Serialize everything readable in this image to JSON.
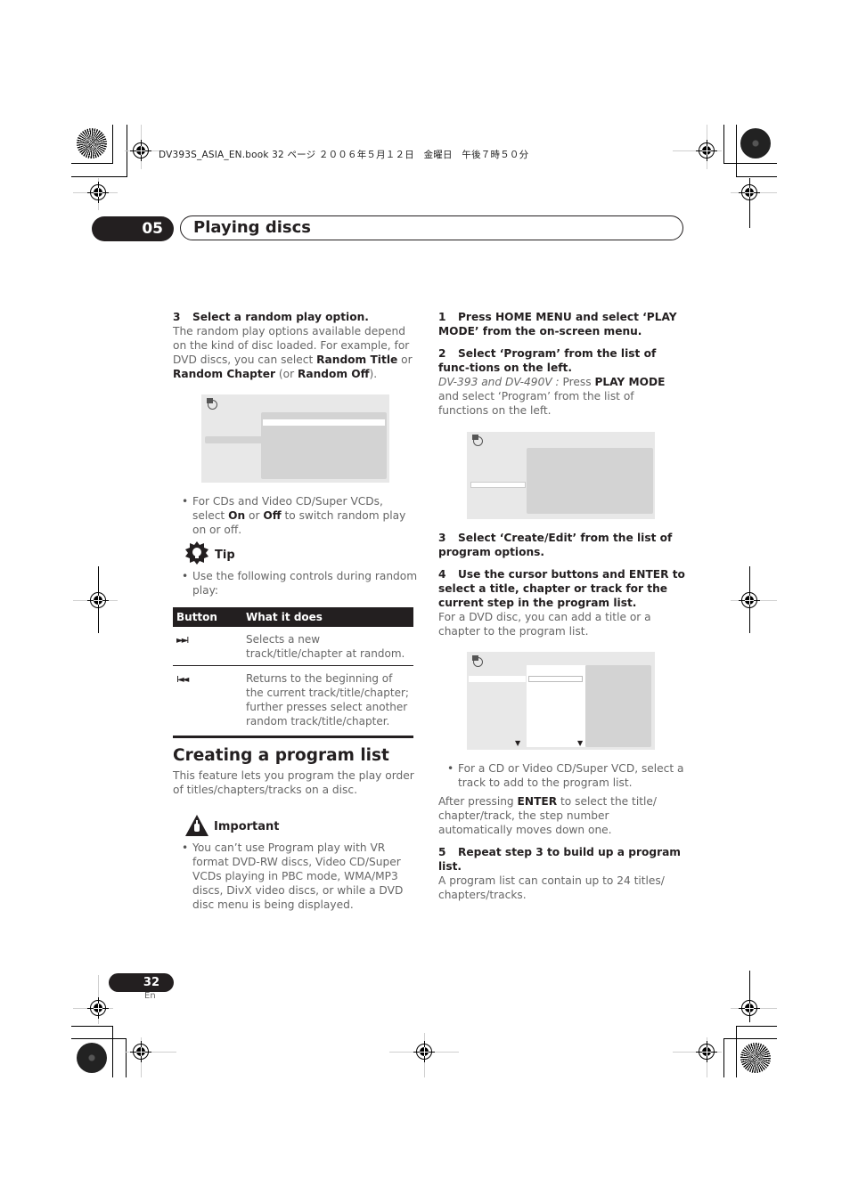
{
  "print_header": "DV393S_ASIA_EN.book  32 ページ  ２００６年５月１２日　金曜日　午後７時５０分",
  "chapter": {
    "number": "05",
    "title": "Playing discs"
  },
  "left_column": {
    "step3": {
      "num": "3",
      "title": "Select a random play option."
    },
    "step3_body": {
      "t1": "The random play options available depend on the kind of disc loaded. For example, for DVD discs, you can select ",
      "b1": "Random Title",
      "t2": " or ",
      "b2": "Random Chapter",
      "t3": " (or ",
      "b3": "Random Off",
      "t4": ")."
    },
    "bullet_cd": {
      "t1": "For CDs and Video CD/Super VCDs, select ",
      "b1": "On",
      "t2": " or ",
      "b2": "Off",
      "t3": " to switch random play on or off."
    },
    "tip": {
      "label": "Tip",
      "bullet": "Use the following controls during random play:"
    },
    "table": {
      "headers": [
        "Button",
        "What it does"
      ],
      "rows": [
        {
          "button": "►►I",
          "icon": "next-icon",
          "desc": "Selects a new track/title/chapter at random."
        },
        {
          "button": "I◄◄",
          "icon": "previous-icon",
          "desc": "Returns to the beginning of the current track/title/chapter; further presses select another random track/title/chapter."
        }
      ]
    },
    "section_title": "Creating a program list",
    "section_intro": "This feature lets you program the play order of titles/chapters/tracks on a disc.",
    "important": {
      "label": "Important",
      "bullet": "You can’t use Program play with VR format DVD-RW discs, Video CD/Super VCDs playing in PBC mode, WMA/MP3 discs, DivX video discs, or while a DVD disc menu is being displayed."
    }
  },
  "right_column": {
    "step1": {
      "num": "1",
      "title": "Press HOME MENU and select ‘PLAY MODE’ from the on-screen menu."
    },
    "step2": {
      "num": "2",
      "title": "Select ‘Program’ from the list of func-tions on the left."
    },
    "step2_body": {
      "i1": "DV-393 and DV-490V :",
      "t1": " Press ",
      "b1": "PLAY MODE",
      "t2": " and select ‘Program’ from the list of functions on the left."
    },
    "step3": {
      "num": "3",
      "title": "Select ‘Create/Edit’ from the list of program options."
    },
    "step4": {
      "num": "4",
      "title": "Use the cursor buttons and ENTER to select a title, chapter or track for the current step in the program list."
    },
    "step4_body": "For a DVD disc, you can add a title or a chapter to the program list.",
    "bullet_cd": "For a CD or Video CD/Super VCD, select a track to add to the program list.",
    "after_enter": {
      "t1": "After pressing ",
      "b1": "ENTER",
      "t2": " to select the title/ chapter/track, the step number automatically moves down one."
    },
    "step5": {
      "num": "5",
      "title": "Repeat step 3 to build up a program list."
    },
    "step5_body": "A program list can contain up to 24 titles/ chapters/tracks."
  },
  "footer": {
    "page_number": "32",
    "language": "En"
  }
}
